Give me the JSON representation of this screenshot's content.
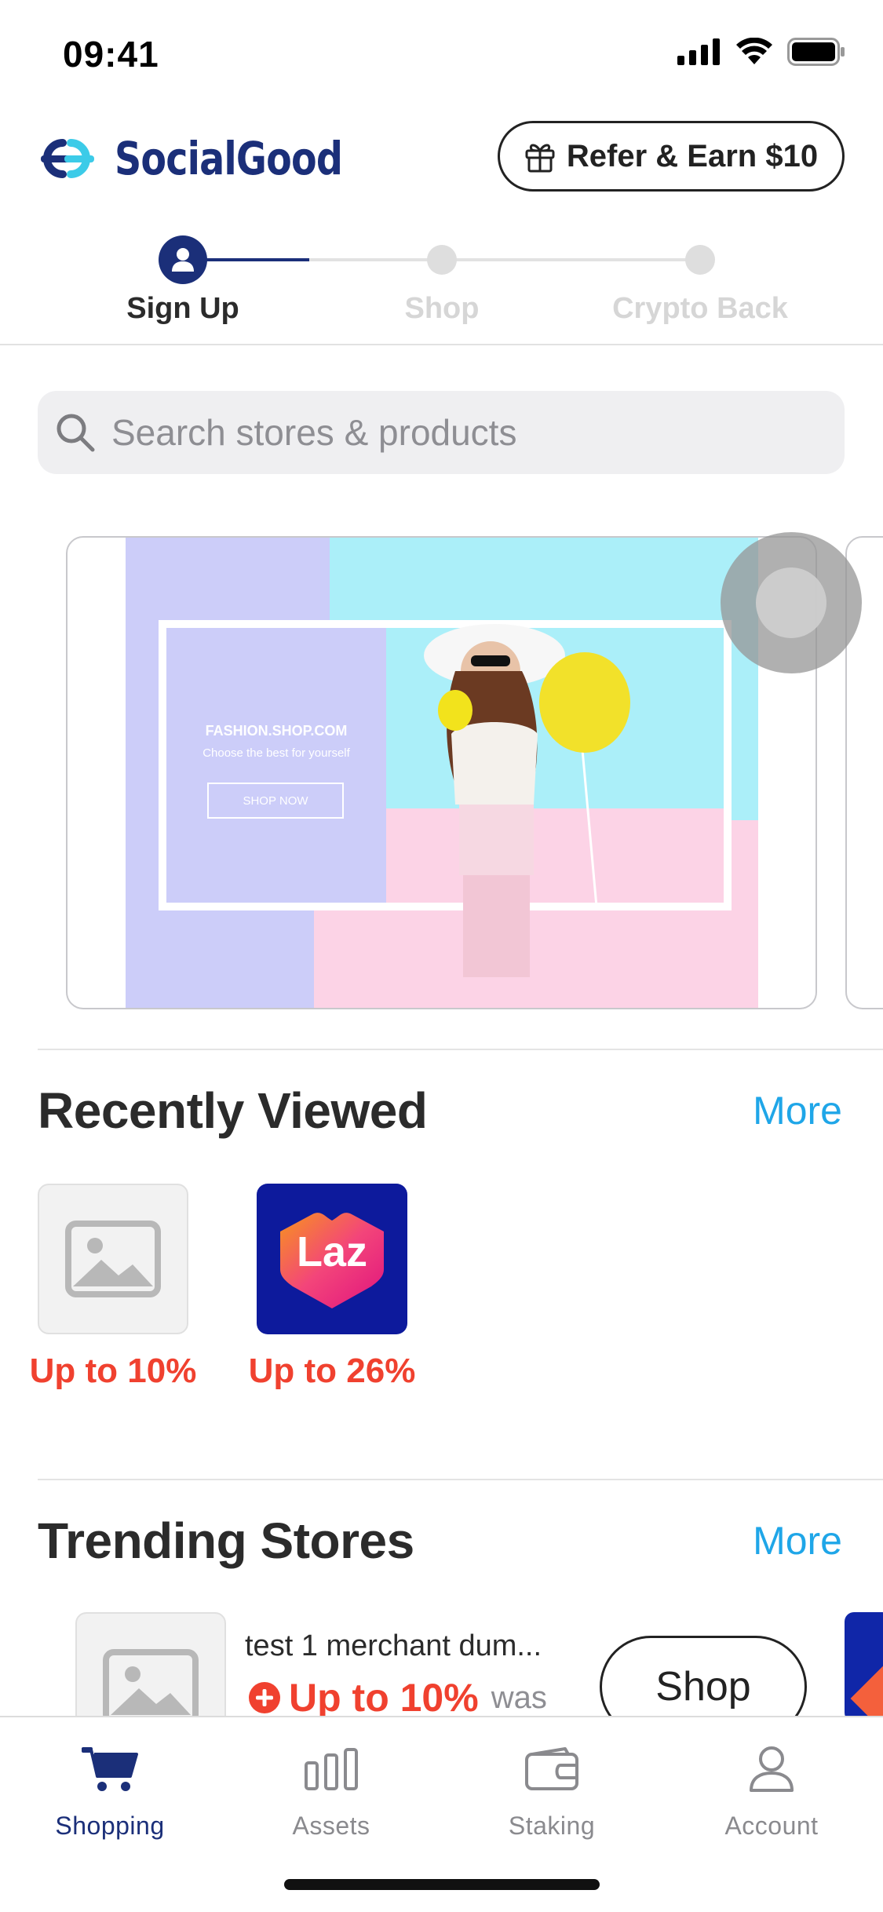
{
  "status_bar": {
    "time": "09:41"
  },
  "header": {
    "brand_name": "SocialGood",
    "refer_button_label": "Refer & Earn $10",
    "brand_color": "#1b2f79"
  },
  "stepper": {
    "steps": [
      {
        "label": "Sign Up",
        "state": "active"
      },
      {
        "label": "Shop",
        "state": "inactive"
      },
      {
        "label": "Crypto Back",
        "state": "inactive"
      }
    ]
  },
  "search": {
    "placeholder": "Search stores & products"
  },
  "banner": {
    "headline": "FASHION.SHOP.COM",
    "tagline": "Choose the best for yourself",
    "cta": "SHOP NOW"
  },
  "recently_viewed": {
    "title": "Recently Viewed",
    "more_label": "More",
    "items": [
      {
        "icon": "image-placeholder-icon",
        "cashback": "Up to 10%"
      },
      {
        "icon": "lazada-logo",
        "logo_text": "Laz",
        "cashback": "Up to 26%"
      }
    ]
  },
  "trending_stores": {
    "title": "Trending Stores",
    "more_label": "More",
    "items": [
      {
        "name": "test 1 merchant dum...",
        "cashback": "Up to 10%",
        "was_label": "was",
        "button_label": "Shop"
      }
    ]
  },
  "tabbar": {
    "tabs": [
      {
        "label": "Shopping",
        "icon": "cart-icon",
        "active": true
      },
      {
        "label": "Assets",
        "icon": "bar-chart-icon",
        "active": false
      },
      {
        "label": "Staking",
        "icon": "wallet-icon",
        "active": false
      },
      {
        "label": "Account",
        "icon": "person-icon",
        "active": false
      }
    ]
  },
  "colors": {
    "accent": "#1fa6e8",
    "cashback": "#f0412f",
    "brand": "#1b2f79"
  }
}
